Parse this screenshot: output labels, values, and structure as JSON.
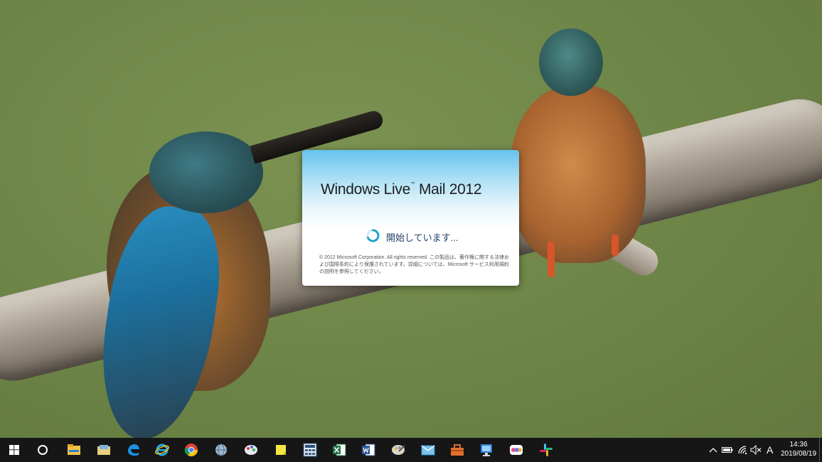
{
  "splash": {
    "brand": "Windows Live",
    "trademark": "™",
    "product": "Mail 2012",
    "status": "開始しています...",
    "copyright": "© 2012 Microsoft Corporation. All rights reserved. この製品は、著作権に関する法律および国際条約により保護されています。詳細については、Microsoft サービス利用規約の説明を参照してください。"
  },
  "taskbar": {
    "apps": [
      {
        "name": "start-button-icon"
      },
      {
        "name": "cortana-search-icon"
      },
      {
        "name": "file-explorer-icon"
      },
      {
        "name": "folder-app-icon"
      },
      {
        "name": "edge-icon"
      },
      {
        "name": "internet-explorer-icon"
      },
      {
        "name": "chrome-icon"
      },
      {
        "name": "network-globe-icon"
      },
      {
        "name": "paint-app-icon"
      },
      {
        "name": "sticky-notes-icon"
      },
      {
        "name": "calculator-icon"
      },
      {
        "name": "excel-icon"
      },
      {
        "name": "word-icon"
      },
      {
        "name": "photo-app-icon"
      },
      {
        "name": "windows-live-mail-icon"
      },
      {
        "name": "toolbox-app-icon"
      },
      {
        "name": "remote-desktop-icon"
      },
      {
        "name": "paint-3d-icon"
      },
      {
        "name": "slack-icon"
      }
    ],
    "ime_mode": "A",
    "clock": {
      "time": "14:36",
      "date": "2019/08/19"
    }
  },
  "colors": {
    "taskbar_bg": "#161616",
    "splash_accent": "#66c2ee",
    "status_text": "#1f3f6a"
  }
}
